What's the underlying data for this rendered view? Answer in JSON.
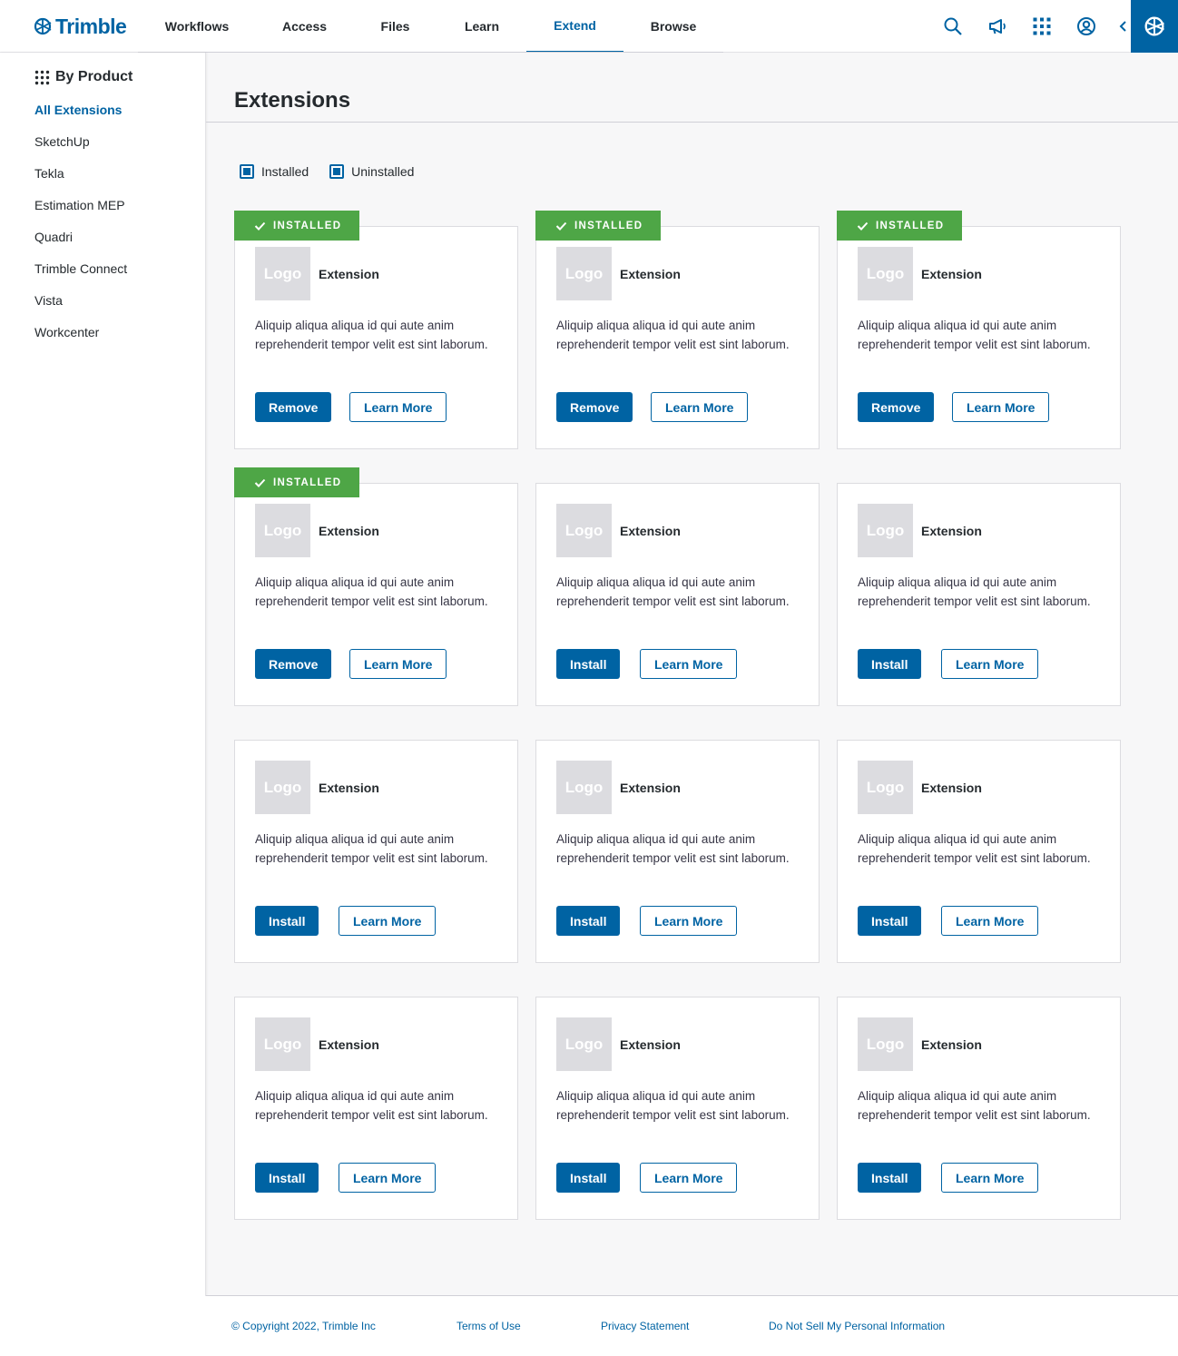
{
  "header": {
    "brand": "Trimble",
    "nav": [
      {
        "label": "Workflows",
        "active": false
      },
      {
        "label": "Access",
        "active": false
      },
      {
        "label": "Files",
        "active": false
      },
      {
        "label": "Learn",
        "active": false
      },
      {
        "label": "Extend",
        "active": true
      },
      {
        "label": "Browse",
        "active": false
      }
    ],
    "icons": [
      "search-icon",
      "megaphone-icon",
      "apps-grid-icon",
      "user-account-icon"
    ]
  },
  "sidebar": {
    "title": "By Product",
    "items": [
      {
        "label": "All Extensions",
        "active": true
      },
      {
        "label": "SketchUp",
        "active": false
      },
      {
        "label": "Tekla",
        "active": false
      },
      {
        "label": "Estimation MEP",
        "active": false
      },
      {
        "label": "Quadri",
        "active": false
      },
      {
        "label": "Trimble Connect",
        "active": false
      },
      {
        "label": "Vista",
        "active": false
      },
      {
        "label": "Workcenter",
        "active": false
      }
    ]
  },
  "main": {
    "title": "Extensions",
    "filters": [
      {
        "label": "Installed",
        "checked": true
      },
      {
        "label": "Uninstalled",
        "checked": true
      }
    ],
    "badge_label": "INSTALLED",
    "cards": [
      {
        "logo": "Logo",
        "name": "Extension",
        "description": "Aliquip aliqua aliqua id qui aute anim reprehenderit tempor velit est sint laborum.",
        "installed": true,
        "action": "Remove",
        "secondary": "Learn More"
      },
      {
        "logo": "Logo",
        "name": "Extension",
        "description": "Aliquip aliqua aliqua id qui aute anim reprehenderit tempor velit est sint laborum.",
        "installed": true,
        "action": "Remove",
        "secondary": "Learn More"
      },
      {
        "logo": "Logo",
        "name": "Extension",
        "description": "Aliquip aliqua aliqua id qui aute anim reprehenderit tempor velit est sint laborum.",
        "installed": true,
        "action": "Remove",
        "secondary": "Learn More"
      },
      {
        "logo": "Logo",
        "name": "Extension",
        "description": "Aliquip aliqua aliqua id qui aute anim reprehenderit tempor velit est sint laborum.",
        "installed": true,
        "action": "Remove",
        "secondary": "Learn More"
      },
      {
        "logo": "Logo",
        "name": "Extension",
        "description": "Aliquip aliqua aliqua id qui aute anim reprehenderit tempor velit est sint laborum.",
        "installed": false,
        "action": "Install",
        "secondary": "Learn More"
      },
      {
        "logo": "Logo",
        "name": "Extension",
        "description": "Aliquip aliqua aliqua id qui aute anim reprehenderit tempor velit est sint laborum.",
        "installed": false,
        "action": "Install",
        "secondary": "Learn More"
      },
      {
        "logo": "Logo",
        "name": "Extension",
        "description": "Aliquip aliqua aliqua id qui aute anim reprehenderit tempor velit est sint laborum.",
        "installed": false,
        "action": "Install",
        "secondary": "Learn More"
      },
      {
        "logo": "Logo",
        "name": "Extension",
        "description": "Aliquip aliqua aliqua id qui aute anim reprehenderit tempor velit est sint laborum.",
        "installed": false,
        "action": "Install",
        "secondary": "Learn More"
      },
      {
        "logo": "Logo",
        "name": "Extension",
        "description": "Aliquip aliqua aliqua id qui aute anim reprehenderit tempor velit est sint laborum.",
        "installed": false,
        "action": "Install",
        "secondary": "Learn More"
      },
      {
        "logo": "Logo",
        "name": "Extension",
        "description": "Aliquip aliqua aliqua id qui aute anim reprehenderit tempor velit est sint laborum.",
        "installed": false,
        "action": "Install",
        "secondary": "Learn More"
      },
      {
        "logo": "Logo",
        "name": "Extension",
        "description": "Aliquip aliqua aliqua id qui aute anim reprehenderit tempor velit est sint laborum.",
        "installed": false,
        "action": "Install",
        "secondary": "Learn More"
      },
      {
        "logo": "Logo",
        "name": "Extension",
        "description": "Aliquip aliqua aliqua id qui aute anim reprehenderit tempor velit est sint laborum.",
        "installed": false,
        "action": "Install",
        "secondary": "Learn More"
      }
    ]
  },
  "footer": {
    "copyright": "© Copyright 2022, Trimble Inc",
    "terms": "Terms of Use",
    "privacy": "Privacy Statement",
    "do_not_sell": "Do Not Sell My Personal Information"
  },
  "colors": {
    "brand_blue": "#0063a3",
    "installed_green": "#4ea646",
    "logo_placeholder": "#dcdce0"
  }
}
